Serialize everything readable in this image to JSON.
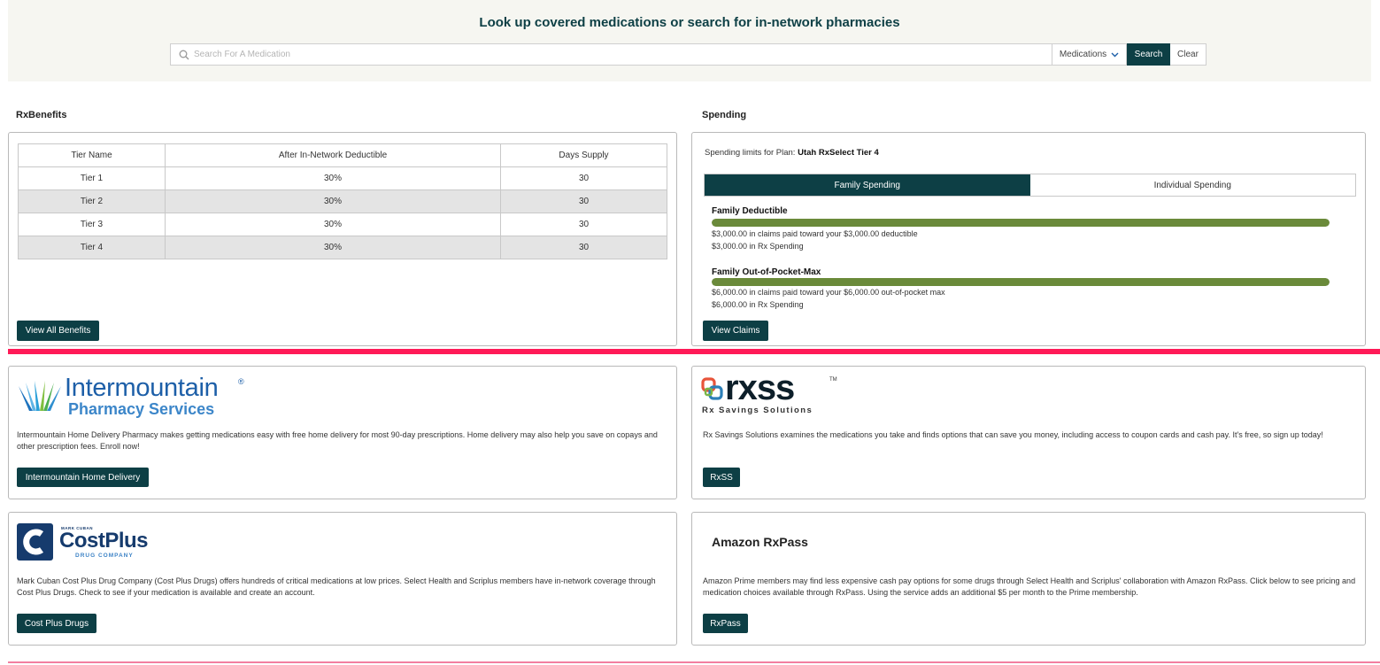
{
  "search": {
    "title": "Look up covered medications or search for in-network pharmacies",
    "placeholder": "Search For A Medication",
    "type_selected": "Medications",
    "search_label": "Search",
    "clear_label": "Clear"
  },
  "rxbenefits": {
    "heading": "RxBenefits",
    "columns": [
      "Tier Name",
      "After In-Network Deductible",
      "Days Supply"
    ],
    "rows": [
      [
        "Tier 1",
        "30%",
        "30"
      ],
      [
        "Tier 2",
        "30%",
        "30"
      ],
      [
        "Tier 3",
        "30%",
        "30"
      ],
      [
        "Tier 4",
        "30%",
        "30"
      ]
    ],
    "button_label": "View All Benefits"
  },
  "spending": {
    "heading": "Spending",
    "plan_prefix": "Spending limits for Plan: ",
    "plan_name": "Utah RxSelect Tier 4",
    "tabs": [
      "Family Spending",
      "Individual Spending"
    ],
    "active_tab": "Family Spending",
    "deductible": {
      "title": "Family Deductible",
      "progress": 1.0,
      "line1": "$3,000.00 in claims paid toward your $3,000.00 deductible",
      "line2": "$3,000.00 in Rx Spending"
    },
    "oop": {
      "title": "Family Out-of-Pocket-Max",
      "progress": 1.0,
      "line1": "$6,000.00 in claims paid toward your $6,000.00 out-of-pocket max",
      "line2": "$6,000.00 in Rx Spending"
    },
    "button_label": "View Claims"
  },
  "promos": {
    "intermountain": {
      "logo_name": "Intermountain",
      "logo_tm": "®",
      "logo_sub": "Pharmacy Services",
      "text": "Intermountain Home Delivery Pharmacy makes getting medications easy with free home delivery for most 90-day prescriptions. Home delivery may also help you save on copays and other prescription fees. Enroll now!",
      "button_label": "Intermountain Home Delivery"
    },
    "rxss": {
      "logo_word": "rxss",
      "logo_tm": "TM",
      "logo_sub": "Rx Savings Solutions",
      "text": "Rx Savings Solutions examines the medications you take and finds options that can save you money, including access to coupon cards and cash pay. It's free, so sign up today!",
      "button_label": "RxSS"
    },
    "costplus": {
      "logo_top": "MARK CUBAN",
      "logo_main": "CostPlus",
      "logo_sub": "DRUG COMPANY",
      "text": "Mark Cuban Cost Plus Drug Company (Cost Plus Drugs) offers hundreds of critical medications at low prices. Select Health and Scriplus members have in-network coverage through Cost Plus Drugs. Check to see if your medication is available and create an account.",
      "button_label": "Cost Plus Drugs"
    },
    "amazon": {
      "logo_text": "Amazon RxPass",
      "text": "Amazon Prime members may find less expensive cash pay options for some drugs through Select Health and Scriplus' collaboration with Amazon RxPass. Click below to see pricing and medication choices available through RxPass. Using the service adds an additional $5 per month to the Prime membership.",
      "button_label": "RxPass"
    }
  },
  "colors": {
    "brand_dark": "#0d3f45",
    "progress_green": "#6a8a3a",
    "divider_pink": "#ff1a57"
  }
}
